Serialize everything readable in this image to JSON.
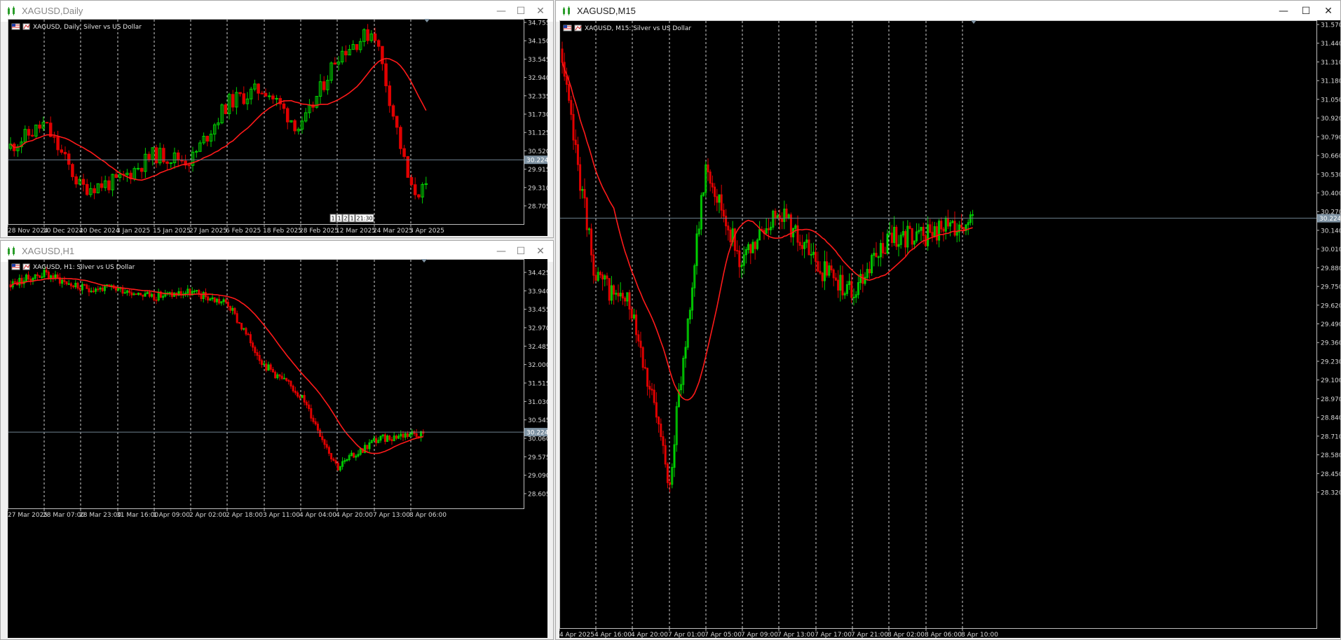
{
  "windows": {
    "daily": {
      "title": "XAGUSD,Daily",
      "chart_label": "XAGUSD, Daily:  Silver vs US Dollar",
      "price_labels": [
        "34.755",
        "34.150",
        "33.545",
        "32.940",
        "32.335",
        "31.730",
        "31.125",
        "30.520",
        "29.915",
        "29.310",
        "28.705"
      ],
      "current_price": "30.224",
      "date_labels": [
        "28 Nov 2024",
        "10 Dec 2024",
        "20 Dec 2024",
        "3 Jan 2025",
        "15 Jan 2025",
        "27 Jan 2025",
        "6 Feb 2025",
        "18 Feb 2025",
        "28 Feb 2025",
        "12 Mar 2025",
        "24 Mar 2025",
        "3 Apr 2025"
      ],
      "countdown": "1 1 2 1 21:30"
    },
    "h1": {
      "title": "XAGUSD,H1",
      "chart_label": "XAGUSD, H1:  Silver vs US Dollar",
      "price_labels": [
        "34.425",
        "33.940",
        "33.455",
        "32.970",
        "32.485",
        "32.000",
        "31.515",
        "31.030",
        "30.545",
        "30.060",
        "29.575",
        "29.090",
        "28.605"
      ],
      "current_price": "30.224",
      "date_labels": [
        "27 Mar 2025",
        "28 Mar 07:00",
        "28 Mar 23:00",
        "31 Mar 16:00",
        "1 Apr 09:00",
        "2 Apr 02:00",
        "2 Apr 18:00",
        "3 Apr 11:00",
        "4 Apr 04:00",
        "4 Apr 20:00",
        "7 Apr 13:00",
        "8 Apr 06:00"
      ]
    },
    "m15": {
      "title": "XAGUSD,M15",
      "chart_label": "XAGUSD, M15:  Silver vs US Dollar",
      "price_labels": [
        "31.570",
        "31.440",
        "31.310",
        "31.180",
        "31.050",
        "30.920",
        "30.790",
        "30.660",
        "30.530",
        "30.400",
        "30.270",
        "30.140",
        "30.010",
        "29.880",
        "29.750",
        "29.620",
        "29.490",
        "29.360",
        "29.230",
        "29.100",
        "28.970",
        "28.840",
        "28.710",
        "28.580",
        "28.450",
        "28.320"
      ],
      "current_price": "30.224",
      "date_labels": [
        "4 Apr 2025",
        "4 Apr 16:00",
        "4 Apr 20:00",
        "7 Apr 01:00",
        "7 Apr 05:00",
        "7 Apr 09:00",
        "7 Apr 13:00",
        "7 Apr 17:00",
        "7 Apr 21:00",
        "8 Apr 02:00",
        "8 Apr 06:00",
        "8 Apr 10:00"
      ]
    }
  },
  "window_buttons": {
    "minimize": "—",
    "maximize": "☐",
    "close": "✕"
  },
  "colors": {
    "bull": "#00d000",
    "bear": "#e00000",
    "ma": "#ff1a1a",
    "bid_line": "#6f8290",
    "grid": "#cfcfcf"
  },
  "icons": {
    "window": "chart-window-icon",
    "flag": "us-flag-icon"
  },
  "chart_data": [
    {
      "type": "line",
      "name": "XAGUSD Daily",
      "x": [
        "28 Nov 2024",
        "10 Dec 2024",
        "20 Dec 2024",
        "3 Jan 2025",
        "15 Jan 2025",
        "27 Jan 2025",
        "6 Feb 2025",
        "18 Feb 2025",
        "28 Feb 2025",
        "12 Mar 2025",
        "24 Mar 2025",
        "3 Apr 2025"
      ],
      "series": [
        {
          "values": [
            30.6,
            31.4,
            29.3,
            29.5,
            30.4,
            30.2,
            32.1,
            32.6,
            31.2,
            33.7,
            34.5,
            29.2
          ]
        }
      ],
      "ylim": [
        28.3,
        34.9
      ]
    },
    {
      "type": "line",
      "name": "XAGUSD H1",
      "x": [
        "27 Mar 2025",
        "28 Mar 07:00",
        "28 Mar 23:00",
        "31 Mar 16:00",
        "1 Apr 09:00",
        "2 Apr 02:00",
        "2 Apr 18:00",
        "3 Apr 11:00",
        "4 Apr 04:00",
        "4 Apr 20:00",
        "7 Apr 13:00",
        "8 Apr 06:00"
      ],
      "series": [
        {
          "values": [
            34.1,
            34.4,
            34.0,
            34.0,
            33.8,
            33.9,
            33.6,
            32.0,
            31.2,
            29.3,
            30.0,
            30.2
          ]
        }
      ],
      "ylim": [
        28.2,
        34.9
      ]
    },
    {
      "type": "line",
      "name": "XAGUSD M15",
      "x": [
        "4 Apr 2025",
        "4 Apr 16:00",
        "4 Apr 20:00",
        "7 Apr 01:00",
        "7 Apr 05:00",
        "7 Apr 09:00",
        "7 Apr 13:00",
        "7 Apr 17:00",
        "7 Apr 21:00",
        "8 Apr 02:00",
        "8 Apr 06:00",
        "8 Apr 10:00"
      ],
      "series": [
        {
          "values": [
            31.4,
            29.8,
            29.6,
            28.4,
            30.6,
            29.9,
            30.3,
            29.9,
            29.7,
            30.1,
            30.1,
            30.2
          ]
        }
      ],
      "ylim": [
        28.2,
        31.6
      ]
    }
  ]
}
